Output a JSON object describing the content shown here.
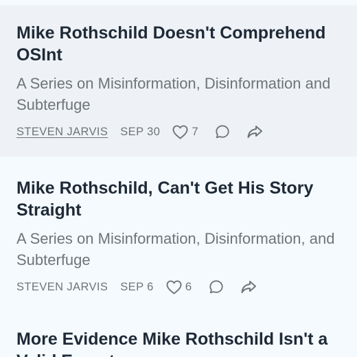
{
  "posts": [
    {
      "title": "Mike Rothschild Doesn't Comprehend OSInt",
      "subtitle": "A Series on Misinformation, Disinformation and Subterfuge",
      "author": "STEVEN JARVIS",
      "date": "SEP 30",
      "likes": "7"
    },
    {
      "title": "Mike Rothschild, Can't Get His Story Straight",
      "subtitle": "A Series on Misinformation, Disinformation, and Subterfuge",
      "author": "STEVEN JARVIS",
      "date": "SEP 6",
      "likes": "6"
    },
    {
      "title": "More Evidence Mike Rothschild Isn't a Valid Expert"
    }
  ],
  "icons": {
    "like": "heart-icon",
    "comment": "comment-icon",
    "share": "share-icon"
  },
  "colors": {
    "title": "#1f2a37",
    "muted": "#6f7479",
    "highlight_bg": "#eef2f6",
    "page_bg": "#f4fafd"
  }
}
